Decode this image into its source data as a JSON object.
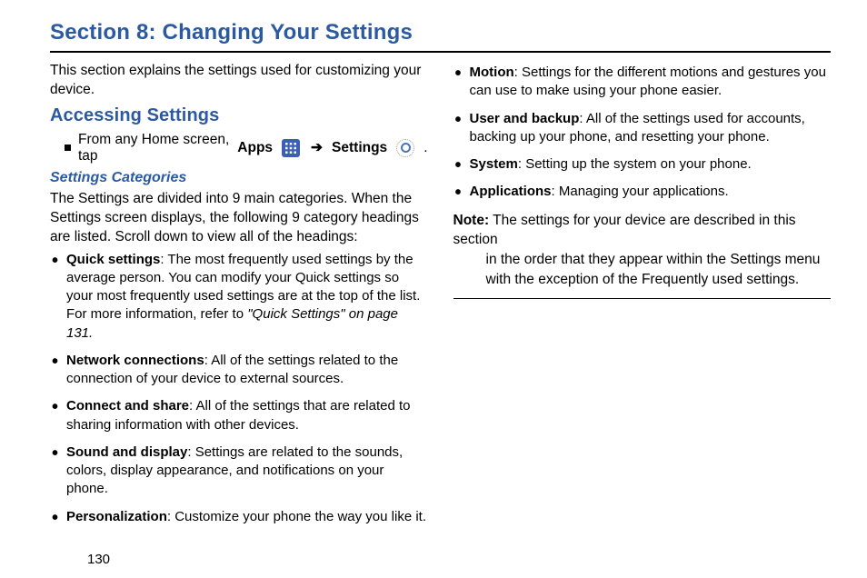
{
  "title": "Section 8: Changing Your Settings",
  "intro": "This section explains the settings used for customizing your device.",
  "h2_access": "Accessing Settings",
  "step_prefix": "From any Home screen, tap",
  "word_apps": "Apps",
  "word_settings": "Settings",
  "h3_categories": "Settings Categories",
  "categories_intro": "The Settings are divided into 9 main categories. When the Settings screen displays, the following 9 category headings are listed. Scroll down to view all of the headings:",
  "categories_left": [
    {
      "name": "Quick settings",
      "desc": ": The most frequently used settings by the average person. You can modify your Quick settings so your most frequently used settings are at the top of the list. For more information, refer to ",
      "refer": "\"Quick Settings\"  on page 131."
    },
    {
      "name": "Network connections",
      "desc": ": All of the settings related to the connection of your device to external sources."
    },
    {
      "name": "Connect and share",
      "desc": ": All of the settings that are related to sharing information with other devices."
    },
    {
      "name": "Sound and display",
      "desc": ": Settings are related to the sounds, colors, display appearance, and notifications on your phone."
    },
    {
      "name": "Personalization",
      "desc": ": Customize your phone the way you like it."
    }
  ],
  "categories_right": [
    {
      "name": "Motion",
      "desc": ": Settings for the different motions and gestures you can use to make using your phone easier."
    },
    {
      "name": "User and backup",
      "desc": ": All of the settings used for accounts, backing up your phone, and resetting your phone."
    },
    {
      "name": "System",
      "desc": ": Setting up the system on your phone."
    },
    {
      "name": "Applications",
      "desc": ": Managing your applications."
    }
  ],
  "note_label": "Note:",
  "note_body_first": " The settings for your device are described in this section",
  "note_body_rest": "in the order that they appear within the Settings menu with the exception of the Frequently used settings.",
  "page_number": "130"
}
